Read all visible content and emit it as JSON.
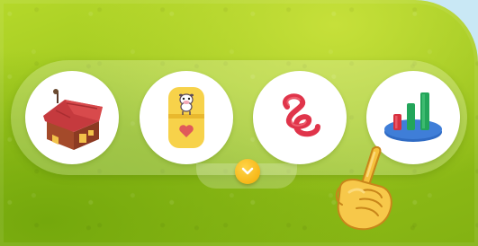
{
  "panel": {
    "items": [
      {
        "name": "barn",
        "icon": "barn-icon"
      },
      {
        "name": "cow-card",
        "icon": "cow-card-icon"
      },
      {
        "name": "spring",
        "icon": "spring-icon"
      },
      {
        "name": "bar-chart",
        "icon": "bar-chart-icon"
      }
    ],
    "expand_icon": "chevron-down-icon",
    "pointer_icon": "hand-pointer-icon"
  },
  "colors": {
    "grass": "#98c31c",
    "tray": "#e5f2c0",
    "item_bg": "#ffffff",
    "expand_button": "#f7b718",
    "barn_roof": "#c53a3e",
    "card_yellow": "#f7d24a",
    "spring_red": "#e0344a",
    "chart_blue": "#2f6bc4",
    "chart_red": "#d8303f",
    "chart_green": "#23a55a"
  }
}
